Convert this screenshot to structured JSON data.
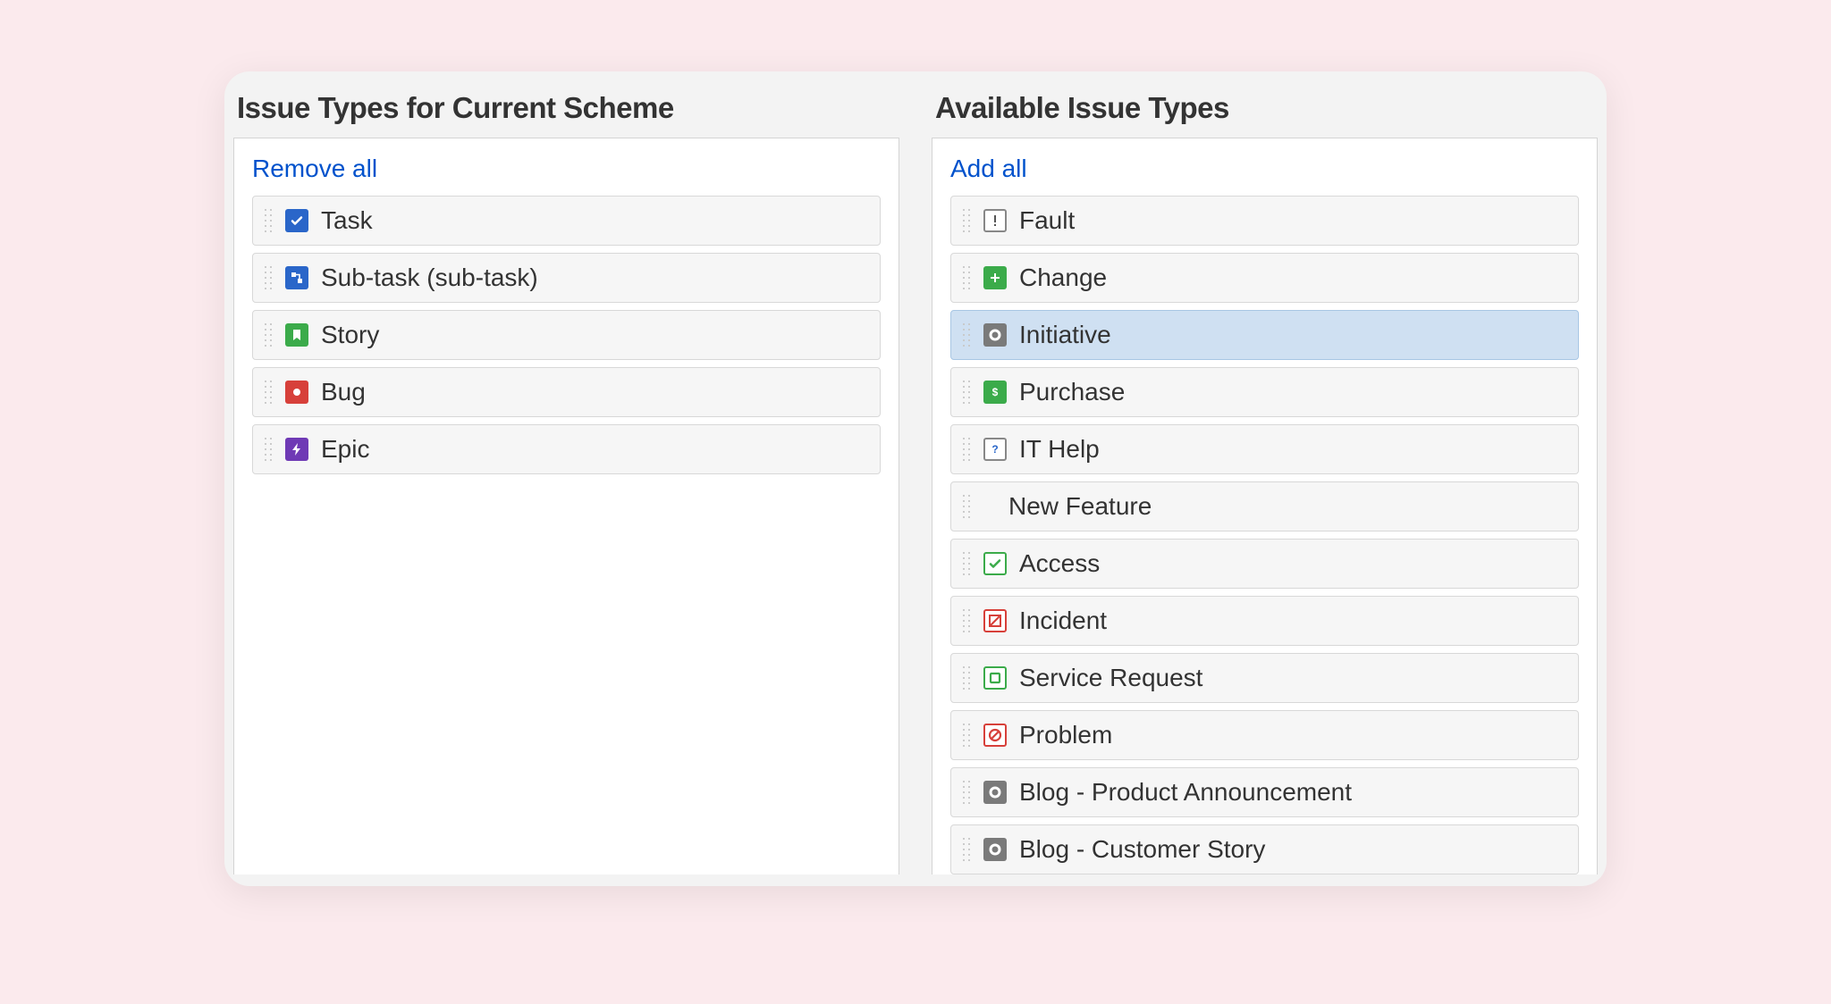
{
  "columns": {
    "current": {
      "title": "Issue Types for Current Scheme",
      "action": "Remove all",
      "items": [
        {
          "label": "Task",
          "icon": "task-icon",
          "icon_cls": "ic-task",
          "glyph": "check",
          "selected": false
        },
        {
          "label": "Sub-task (sub-task)",
          "icon": "subtask-icon",
          "icon_cls": "ic-subtask",
          "glyph": "branch",
          "selected": false
        },
        {
          "label": "Story",
          "icon": "story-icon",
          "icon_cls": "ic-story",
          "glyph": "bookmark",
          "selected": false
        },
        {
          "label": "Bug",
          "icon": "bug-icon",
          "icon_cls": "ic-bug",
          "glyph": "dot",
          "selected": false
        },
        {
          "label": "Epic",
          "icon": "epic-icon",
          "icon_cls": "ic-epic",
          "glyph": "bolt",
          "selected": false
        }
      ]
    },
    "available": {
      "title": "Available Issue Types",
      "action": "Add all",
      "items": [
        {
          "label": "Fault",
          "icon": "fault-icon",
          "icon_cls": "ic-fault",
          "glyph": "exclaim",
          "selected": false
        },
        {
          "label": "Change",
          "icon": "change-icon",
          "icon_cls": "ic-change",
          "glyph": "plus",
          "selected": false
        },
        {
          "label": "Initiative",
          "icon": "initiative-icon",
          "icon_cls": "ic-initiative",
          "glyph": "ring",
          "selected": true
        },
        {
          "label": "Purchase",
          "icon": "purchase-icon",
          "icon_cls": "ic-purchase",
          "glyph": "dollar",
          "selected": false
        },
        {
          "label": "IT Help",
          "icon": "ithelp-icon",
          "icon_cls": "ic-ithelp",
          "glyph": "question",
          "selected": false
        },
        {
          "label": "New Feature",
          "icon": "",
          "icon_cls": "",
          "glyph": "",
          "selected": false
        },
        {
          "label": "Access",
          "icon": "access-icon",
          "icon_cls": "ic-access",
          "glyph": "check",
          "selected": false
        },
        {
          "label": "Incident",
          "icon": "incident-icon",
          "icon_cls": "ic-incident",
          "glyph": "slash",
          "selected": false
        },
        {
          "label": "Service Request",
          "icon": "service-icon",
          "icon_cls": "ic-service",
          "glyph": "square",
          "selected": false
        },
        {
          "label": "Problem",
          "icon": "problem-icon",
          "icon_cls": "ic-problem",
          "glyph": "noentry",
          "selected": false
        },
        {
          "label": "Blog - Product Announcement",
          "icon": "blog-icon",
          "icon_cls": "ic-blog",
          "glyph": "ring",
          "selected": false
        },
        {
          "label": "Blog - Customer Story",
          "icon": "blog-icon",
          "icon_cls": "ic-blog",
          "glyph": "ring",
          "selected": false
        }
      ]
    }
  }
}
